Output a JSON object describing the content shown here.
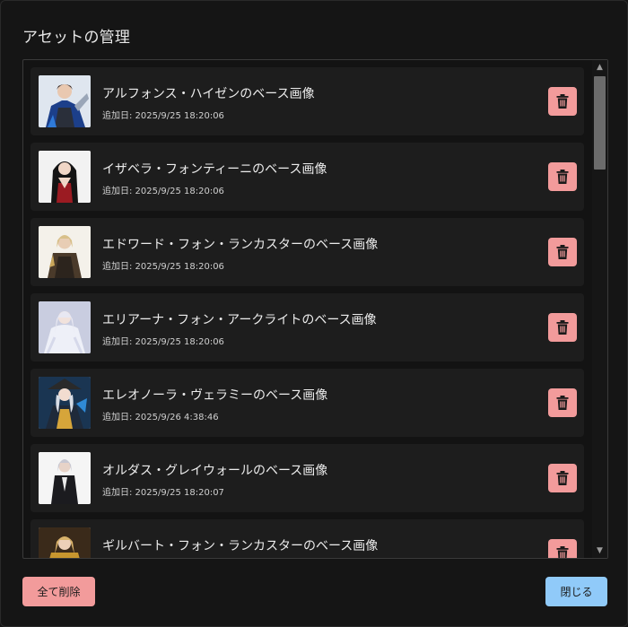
{
  "dialog": {
    "title": "アセットの管理",
    "delete_all_label": "全て削除",
    "close_label": "閉じる"
  },
  "assets": [
    {
      "name": "アルフォンス・ハイゼンのベース画像",
      "date": "追加日: 2025/9/25 18:20:06"
    },
    {
      "name": "イザベラ・フォンティーニのベース画像",
      "date": "追加日: 2025/9/25 18:20:06"
    },
    {
      "name": "エドワード・フォン・ランカスターのベース画像",
      "date": "追加日: 2025/9/25 18:20:06"
    },
    {
      "name": "エリアーナ・フォン・アークライトのベース画像",
      "date": "追加日: 2025/9/25 18:20:06"
    },
    {
      "name": "エレオノーラ・ヴェラミーのベース画像",
      "date": "追加日: 2025/9/26 4:38:46"
    },
    {
      "name": "オルダス・グレイウォールのベース画像",
      "date": "追加日: 2025/9/25 18:20:07"
    },
    {
      "name": "ギルバート・フォン・ランカスターのベース画像",
      "date": ""
    }
  ],
  "colors": {
    "danger": "#f29b9b",
    "primary": "#90caf9",
    "background": "#151515",
    "item_background": "#1d1d1d"
  },
  "icons": {
    "delete": "trash-icon",
    "scroll_up": "chevron-up-icon",
    "scroll_down": "chevron-down-icon"
  }
}
